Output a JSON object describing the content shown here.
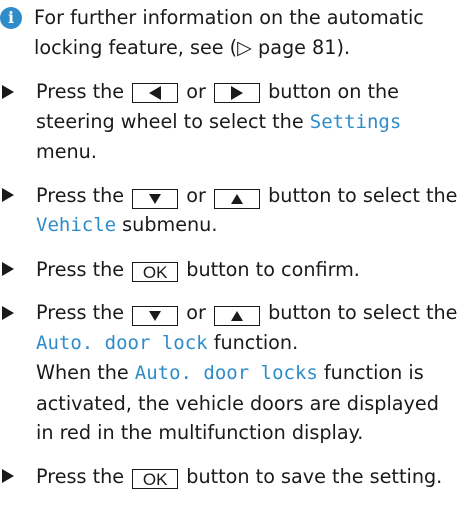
{
  "colors": {
    "accent": "#2e8cc9",
    "text": "#1a1a1a"
  },
  "info": {
    "icon": "info-icon",
    "text": "For further information on the automatic locking feature, see (▷ page 81)."
  },
  "steps": [
    {
      "p1": "Press the ",
      "key1": "left-arrow",
      "p2": " or ",
      "key2": "right-arrow",
      "p3": " button on the steering wheel to select the ",
      "disp1": "Settings",
      "p4": " menu."
    },
    {
      "p1": "Press the ",
      "key1": "down-arrow",
      "p2": " or ",
      "key2": "up-arrow",
      "p3": " button to select the ",
      "disp1": "Vehicle",
      "p4": " submenu."
    },
    {
      "p1": "Press the ",
      "key1": "OK",
      "p2": " button to confirm."
    },
    {
      "p1": "Press the ",
      "key1": "down-arrow",
      "p2": " or ",
      "key2": "up-arrow",
      "p3": " button to select the ",
      "disp1": "Auto. door lock",
      "p4": " function.",
      "p5": "When the ",
      "disp2": "Auto. door locks",
      "p6": " function is activated, the vehicle doors are displayed in red in the multifunction display."
    },
    {
      "p1": "Press the ",
      "key1": "OK",
      "p2": " button to save the setting."
    }
  ]
}
